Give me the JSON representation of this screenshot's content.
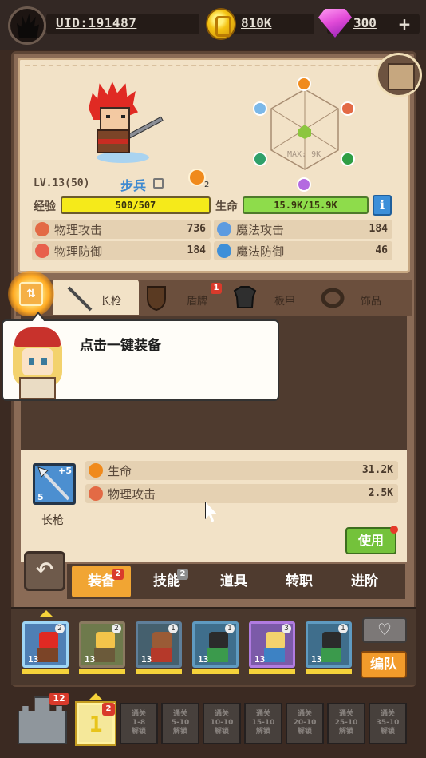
{
  "topbar": {
    "uid": "UID:191487",
    "gold": "810K",
    "gems": "300",
    "plus": "+"
  },
  "hero": {
    "level": "LV.13(50)",
    "class_name": "步兵",
    "class_badge_count": "2",
    "radar_max": "MAX: 9K",
    "exp_label": "经验",
    "exp_value": "500/507",
    "hp_label": "生命",
    "hp_value": "15.9K/15.9K",
    "info": "i",
    "stats": [
      {
        "label": "物理攻击",
        "value": "736",
        "icon": "sword-icon",
        "color": "#e36a45"
      },
      {
        "label": "魔法攻击",
        "value": "184",
        "icon": "magic-icon",
        "color": "#5d9be0"
      },
      {
        "label": "物理防御",
        "value": "184",
        "icon": "shield-icon",
        "color": "#e8604c"
      },
      {
        "label": "魔法防御",
        "value": "46",
        "icon": "magic-shield-icon",
        "color": "#3e8fd8"
      }
    ]
  },
  "equip_tabs": [
    {
      "label": "长枪",
      "icon": "spear-icon"
    },
    {
      "label": "盾牌",
      "icon": "shield-icon",
      "badge": "1"
    },
    {
      "label": "板甲",
      "icon": "armor-icon"
    },
    {
      "label": "饰品",
      "icon": "ring-icon"
    }
  ],
  "tutorial": {
    "text": "点击一键装备"
  },
  "item_detail": {
    "name": "长枪",
    "plus_top": "+5",
    "plus_bottom": "5",
    "stats": [
      {
        "label": "生命",
        "value": "31.2K",
        "icon": "heart-icon",
        "color": "#f08a1c"
      },
      {
        "label": "物理攻击",
        "value": "2.5K",
        "icon": "sword-icon",
        "color": "#e36a45"
      }
    ],
    "use_button": "使用"
  },
  "nav": {
    "tabs": [
      {
        "label": "装备",
        "badge": "2"
      },
      {
        "label": "技能",
        "badge": "2"
      },
      {
        "label": "道具"
      },
      {
        "label": "转职"
      },
      {
        "label": "进阶"
      }
    ]
  },
  "team": {
    "heroes": [
      {
        "level": "13",
        "count": "2",
        "border": "#9ed5f5",
        "bg": "#4f7fb4",
        "head": "#e02a23",
        "body": "#7b4427"
      },
      {
        "level": "13",
        "count": "2",
        "border": "#8a7a60",
        "bg": "#6e7a4c",
        "head": "#f3c44a",
        "body": "#6b5a3a"
      },
      {
        "level": "13",
        "count": "1",
        "border": "#5f7f9a",
        "bg": "#45606e",
        "head": "#9a5b36",
        "body": "#b5392a"
      },
      {
        "level": "13",
        "count": "1",
        "border": "#5f9ac0",
        "bg": "#3f6e8c",
        "head": "#2b2b2b",
        "body": "#3b9a4c"
      },
      {
        "level": "13",
        "count": "3",
        "border": "#b07be0",
        "bg": "#7b5aa8",
        "head": "#f3d26d",
        "body": "#3d82c4"
      },
      {
        "level": "13",
        "count": "1",
        "border": "#5f9ac0",
        "bg": "#3f6e8c",
        "head": "#2b2b2b",
        "body": "#3b9a4c"
      }
    ],
    "team_button": "编队"
  },
  "stages": {
    "castle_badge": "12",
    "current": "1",
    "current_badge": "2",
    "locked": [
      [
        "通关",
        "1-8",
        "解锁"
      ],
      [
        "通关",
        "5-10",
        "解锁"
      ],
      [
        "通关",
        "10-10",
        "解锁"
      ],
      [
        "通关",
        "15-10",
        "解锁"
      ],
      [
        "通关",
        "20-10",
        "解锁"
      ],
      [
        "通关",
        "25-10",
        "解锁"
      ],
      [
        "通关",
        "35-10",
        "解锁"
      ]
    ]
  }
}
